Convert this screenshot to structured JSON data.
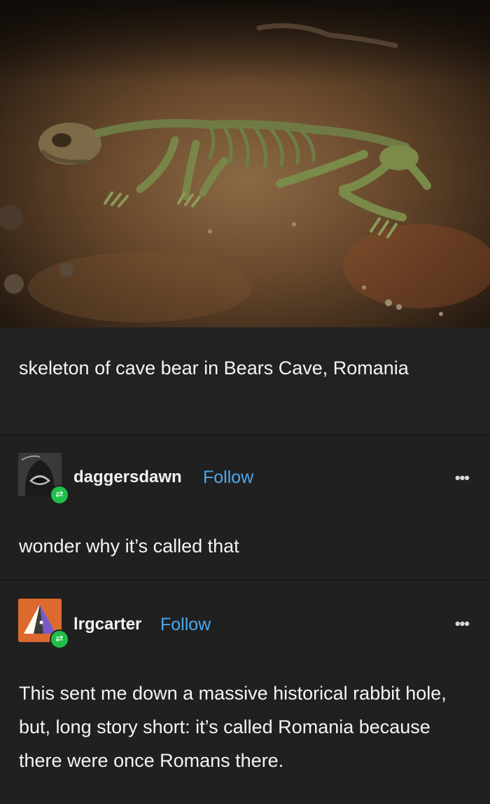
{
  "post": {
    "image_alt": "skeleton of cave bear",
    "caption": "skeleton of cave bear in Bears Cave, Romania"
  },
  "reblogs": [
    {
      "username": "daggersdawn",
      "follow_label": "Follow",
      "more_label": "•••",
      "text": "wonder why it’s called that",
      "avatar_icon": "hooded-figure-avatar"
    },
    {
      "username": "lrgcarter",
      "follow_label": "Follow",
      "more_label": "•••",
      "text": "This sent me down a massive historical rabbit hole, but, long story short: it’s called Romania because there were once Romans there.",
      "avatar_icon": "triangle-logo-avatar"
    }
  ],
  "colors": {
    "background": "#1c1c1c",
    "follow_link": "#4aa8f0",
    "reblog_badge": "#1fbf4a",
    "avatar_2_bg": "#dc6a2e"
  }
}
